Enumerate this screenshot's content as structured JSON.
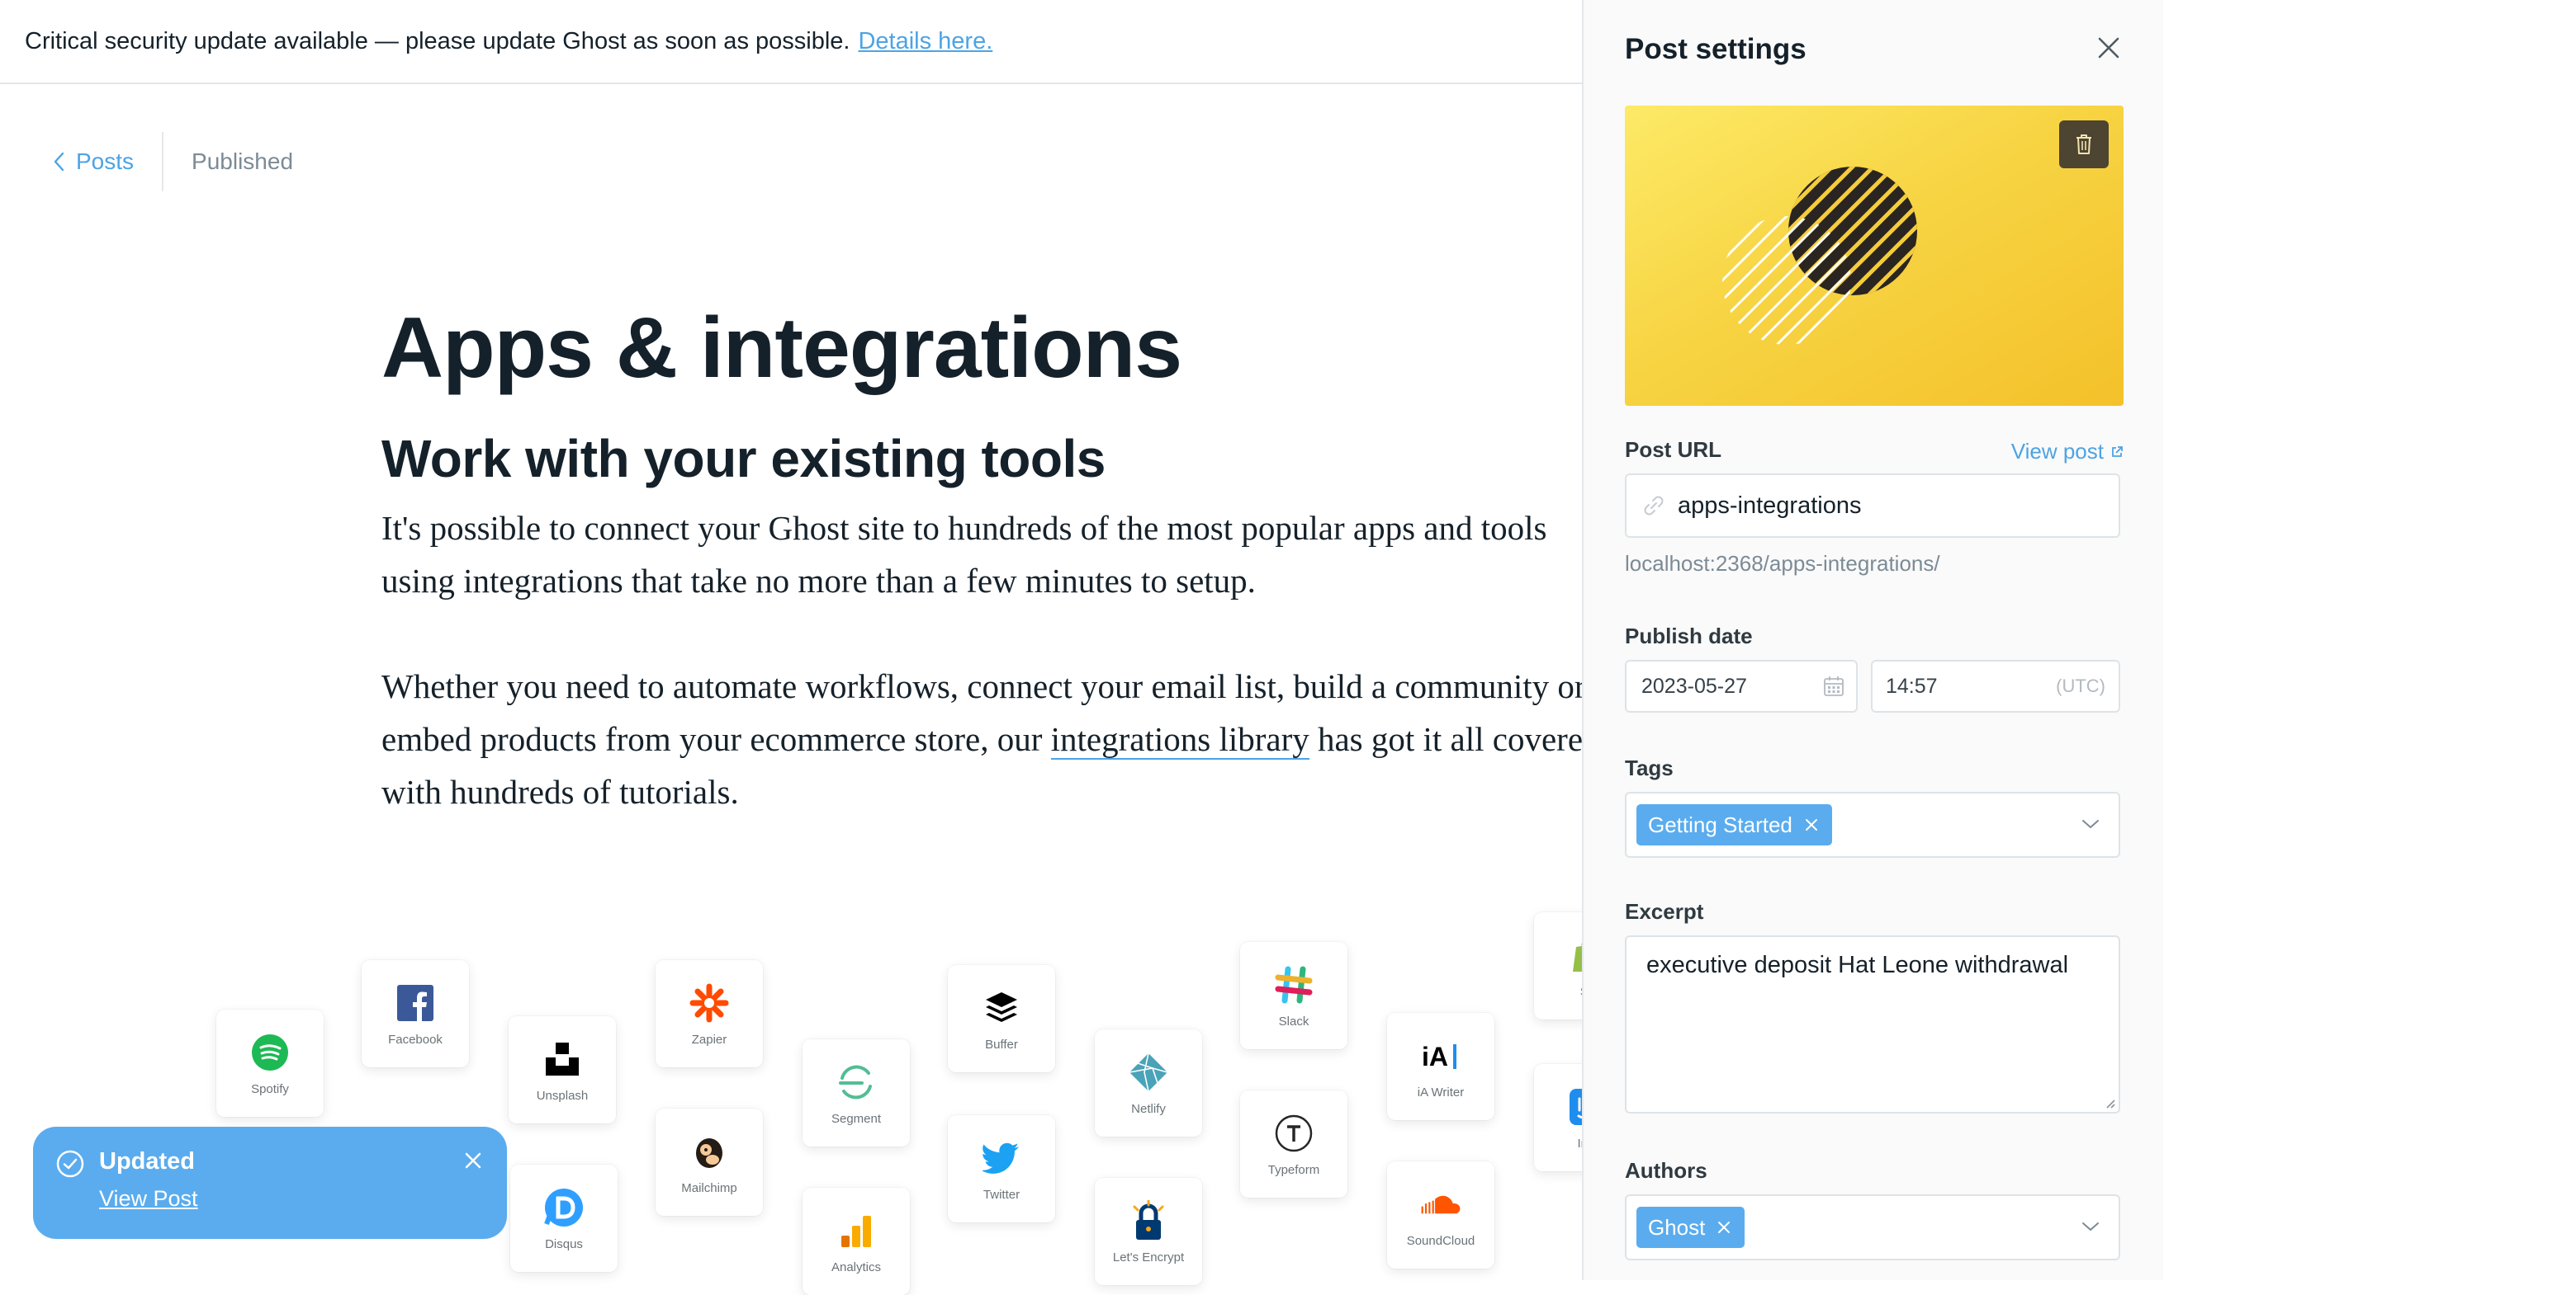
{
  "banner": {
    "text": "Critical security update available — please update Ghost as soon as possible.",
    "link": "Details here."
  },
  "breadcrumb": {
    "back": "Posts",
    "status": "Published"
  },
  "article": {
    "title": "Apps & integrations",
    "subtitle": "Work with your existing tools",
    "p1": "It's possible to connect your Ghost site to hundreds of the most popular apps and tools using integrations that take no more than a few minutes to setup.",
    "p2_before": "Whether you need to automate workflows, connect your email list, build a community or embed products from your ecommerce store, our ",
    "p2_link": "integrations library",
    "p2_after": " has got it all covered with hundreds of tutorials."
  },
  "apps": [
    {
      "label": "Spotify",
      "icon": "spotify-icon",
      "color": "#1db954"
    },
    {
      "label": "Facebook",
      "icon": "facebook-icon",
      "color": "#3b5998"
    },
    {
      "label": "Unsplash",
      "icon": "unsplash-icon",
      "color": "#000000"
    },
    {
      "label": "Disqus",
      "icon": "disqus-icon",
      "color": "#2e9fff"
    },
    {
      "label": "Zapier",
      "icon": "zapier-icon",
      "color": "#ff4a00"
    },
    {
      "label": "Mailchimp",
      "icon": "mailchimp-icon",
      "color": "#241c15"
    },
    {
      "label": "Segment",
      "icon": "segment-icon",
      "color": "#52bd94"
    },
    {
      "label": "Analytics",
      "icon": "analytics-icon",
      "color": "#f9ab00"
    },
    {
      "label": "Buffer",
      "icon": "buffer-icon",
      "color": "#000000"
    },
    {
      "label": "Twitter",
      "icon": "twitter-icon",
      "color": "#1da1f2"
    },
    {
      "label": "Netlify",
      "icon": "netlify-icon",
      "color": "#4aa3b8"
    },
    {
      "label": "Let's Encrypt",
      "icon": "letsencrypt-icon",
      "color": "#003a70"
    },
    {
      "label": "Slack",
      "icon": "slack-icon",
      "color": "#e01e5a"
    },
    {
      "label": "Typeform",
      "icon": "typeform-icon",
      "color": "#262627"
    },
    {
      "label": "iA Writer",
      "icon": "iawriter-icon",
      "color": "#000000"
    },
    {
      "label": "SoundCloud",
      "icon": "soundcloud-icon",
      "color": "#ff5500"
    },
    {
      "label": "Sh",
      "icon": "shopify-icon",
      "color": "#95bf47"
    },
    {
      "label": "Inte",
      "icon": "intercom-icon",
      "color": "#1f8ded"
    }
  ],
  "toast": {
    "title": "Updated",
    "link": "View Post"
  },
  "panel": {
    "title": "Post settings",
    "post_url_label": "Post URL",
    "view_post": "View post",
    "slug": "apps-integrations",
    "full_url": "localhost:2368/apps-integrations/",
    "publish_date_label": "Publish date",
    "date": "2023-05-27",
    "time": "14:57",
    "timezone": "(UTC)",
    "tags_label": "Tags",
    "tags": [
      "Getting Started"
    ],
    "excerpt_label": "Excerpt",
    "excerpt": "executive deposit Hat Leone withdrawal",
    "authors_label": "Authors",
    "authors": [
      "Ghost"
    ]
  },
  "colors": {
    "accent": "#4da3e4",
    "toast": "#5aacee",
    "text": "#15212a"
  }
}
